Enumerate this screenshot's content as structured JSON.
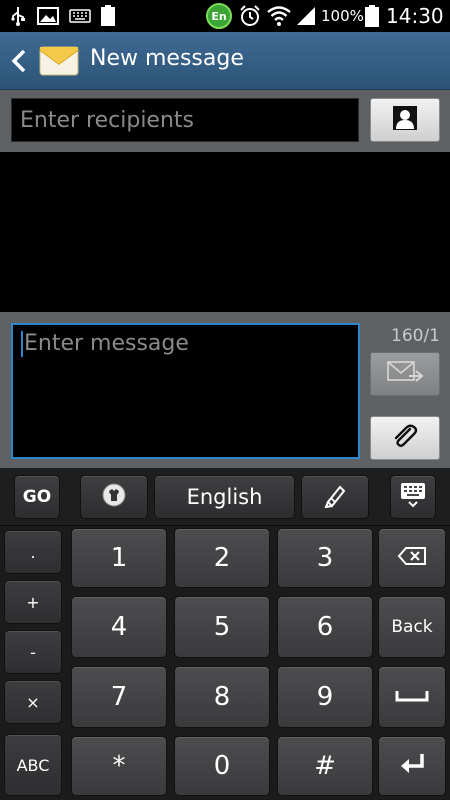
{
  "status_bar": {
    "battery_percent": "100%",
    "time": "14:30",
    "language_badge": "En",
    "usb_icon": "usb-icon",
    "image_icon": "image-icon",
    "keyboard_icon": "keyboard-icon",
    "battery_small_label": "100"
  },
  "action_bar": {
    "title": "New message",
    "back_icon": "chevron-left-icon",
    "app_icon": "envelope-icon"
  },
  "recipients": {
    "placeholder": "Enter recipients",
    "contact_icon": "contact-person-icon"
  },
  "compose": {
    "placeholder": "Enter message",
    "char_counter": "160/1",
    "send_icon": "send-message-icon",
    "attach_icon": "paperclip-icon"
  },
  "keyboard": {
    "toolbar": {
      "go_label": "GO",
      "language_label": "English",
      "settings_icon": "keyboard-settings-icon",
      "handwriting_icon": "pen-icon",
      "hide_icon": "keyboard-hide-icon"
    },
    "side_keys": [
      ".",
      "+",
      "-",
      "×",
      "ABC"
    ],
    "digits": [
      "1",
      "2",
      "3",
      "4",
      "5",
      "6",
      "7",
      "8",
      "9",
      "*",
      "0",
      "#"
    ],
    "back_label": "Back",
    "backspace_icon": "backspace-icon",
    "space_icon": "space-icon",
    "enter_icon": "enter-icon"
  }
}
